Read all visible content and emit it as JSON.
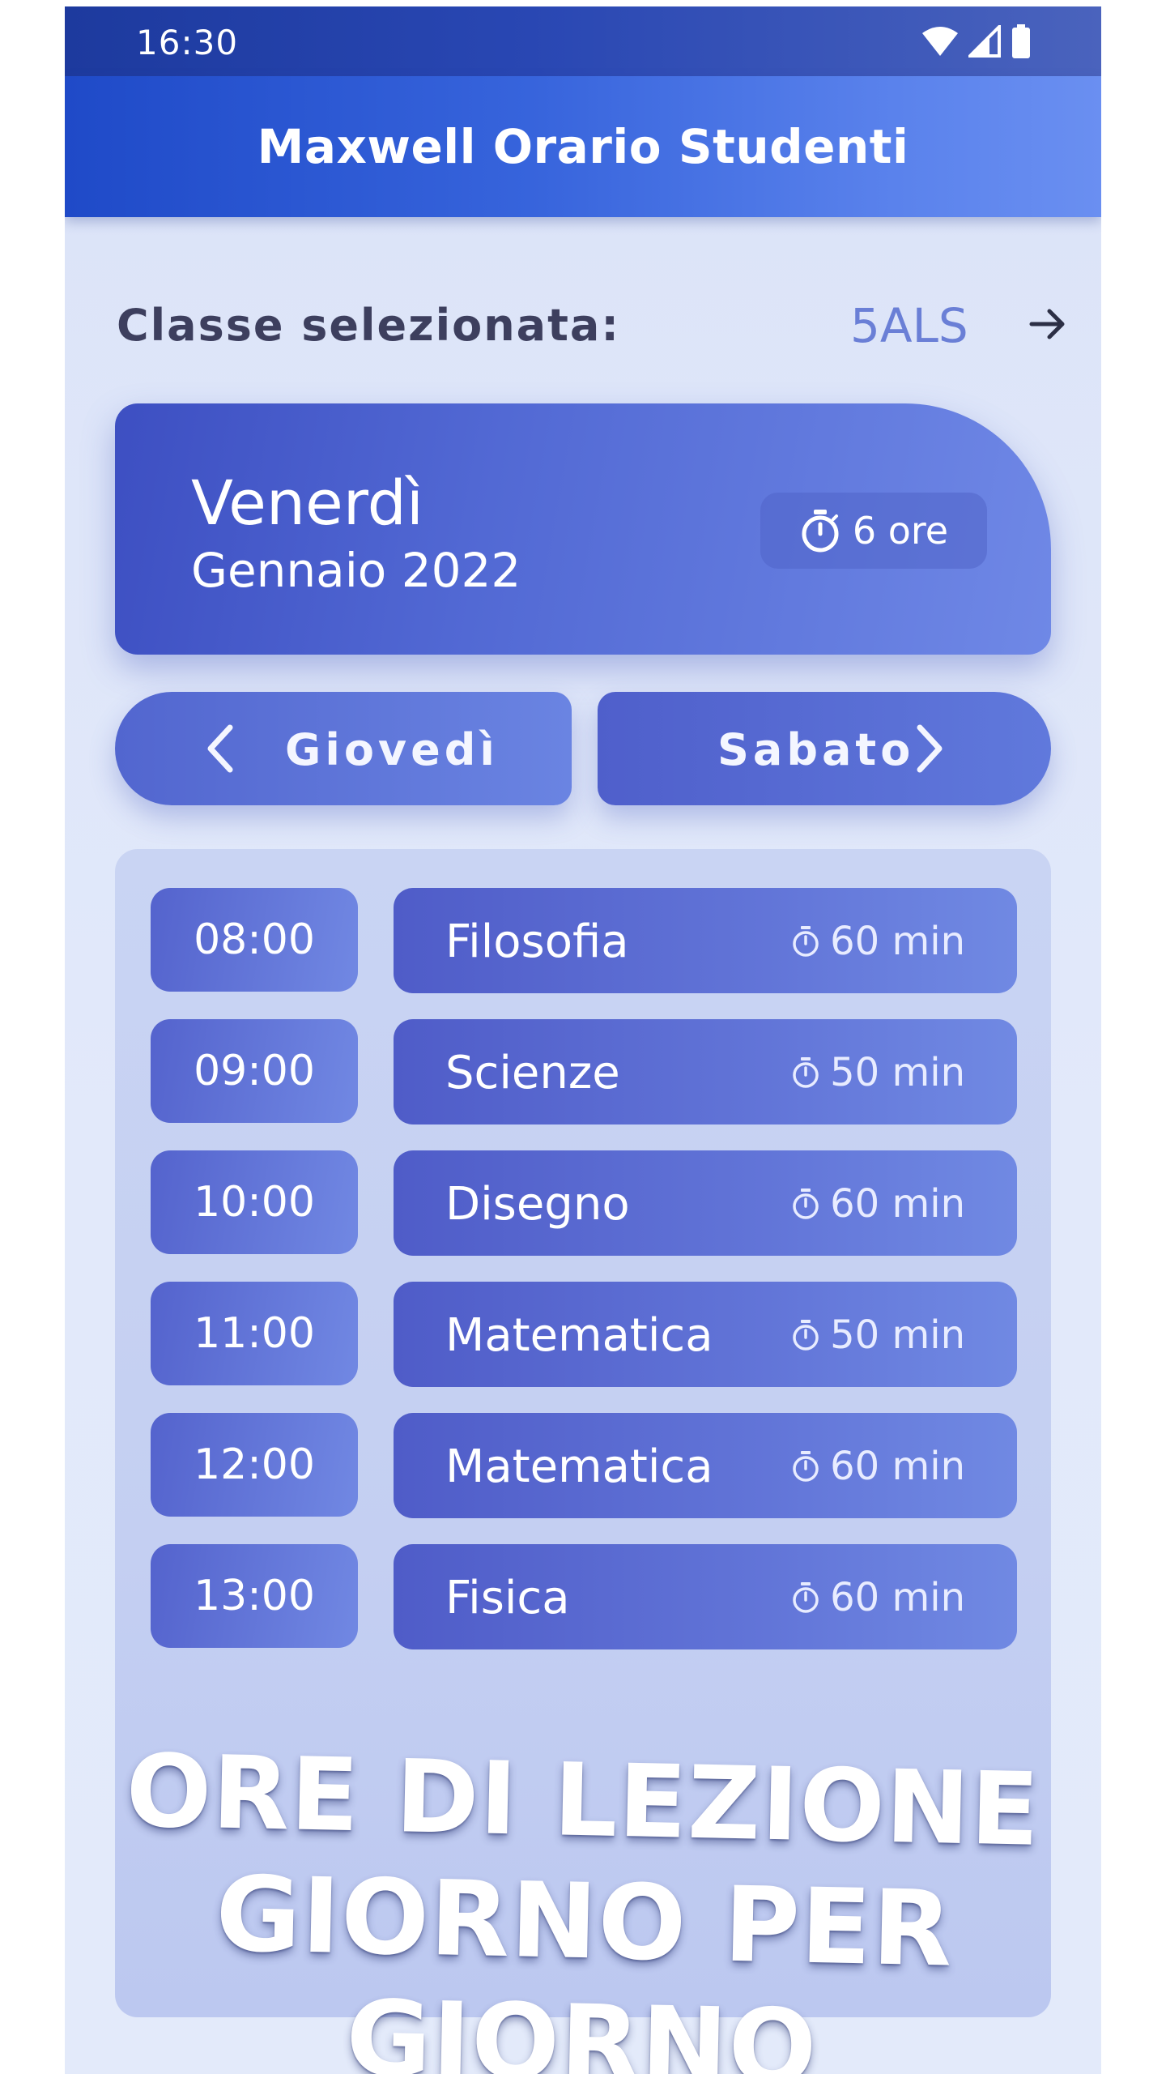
{
  "status_bar": {
    "time": "16:30",
    "icons": [
      "wifi-icon",
      "cell-signal-icon",
      "battery-icon"
    ]
  },
  "app_bar": {
    "title": "Maxwell Orario Studenti"
  },
  "class_selector": {
    "label": "Classe selezionata:",
    "value": "5ALS",
    "icon": "arrow-right-icon"
  },
  "day_card": {
    "day": "Venerdì",
    "month_year": "Gennaio 2022",
    "hours": "6 ore",
    "icon": "stopwatch-icon"
  },
  "navigation": {
    "prev_label": "Giovedì",
    "next_label": "Sabato"
  },
  "lessons": [
    {
      "time": "08:00",
      "subject": "Filosofia",
      "duration": "60 min"
    },
    {
      "time": "09:00",
      "subject": "Scienze",
      "duration": "50 min"
    },
    {
      "time": "10:00",
      "subject": "Disegno",
      "duration": "60 min"
    },
    {
      "time": "11:00",
      "subject": "Matematica",
      "duration": "50 min"
    },
    {
      "time": "12:00",
      "subject": "Matematica",
      "duration": "60 min"
    },
    {
      "time": "13:00",
      "subject": "Fisica",
      "duration": "60 min"
    }
  ],
  "promo": {
    "line1": "ORE DI LEZIONE",
    "line2": "GIORNO PER GIORNO"
  },
  "colors": {
    "primary": "#3764dc",
    "accent": "#6a7fd6",
    "card": "#5269d4",
    "background": "#dbe3f8"
  }
}
